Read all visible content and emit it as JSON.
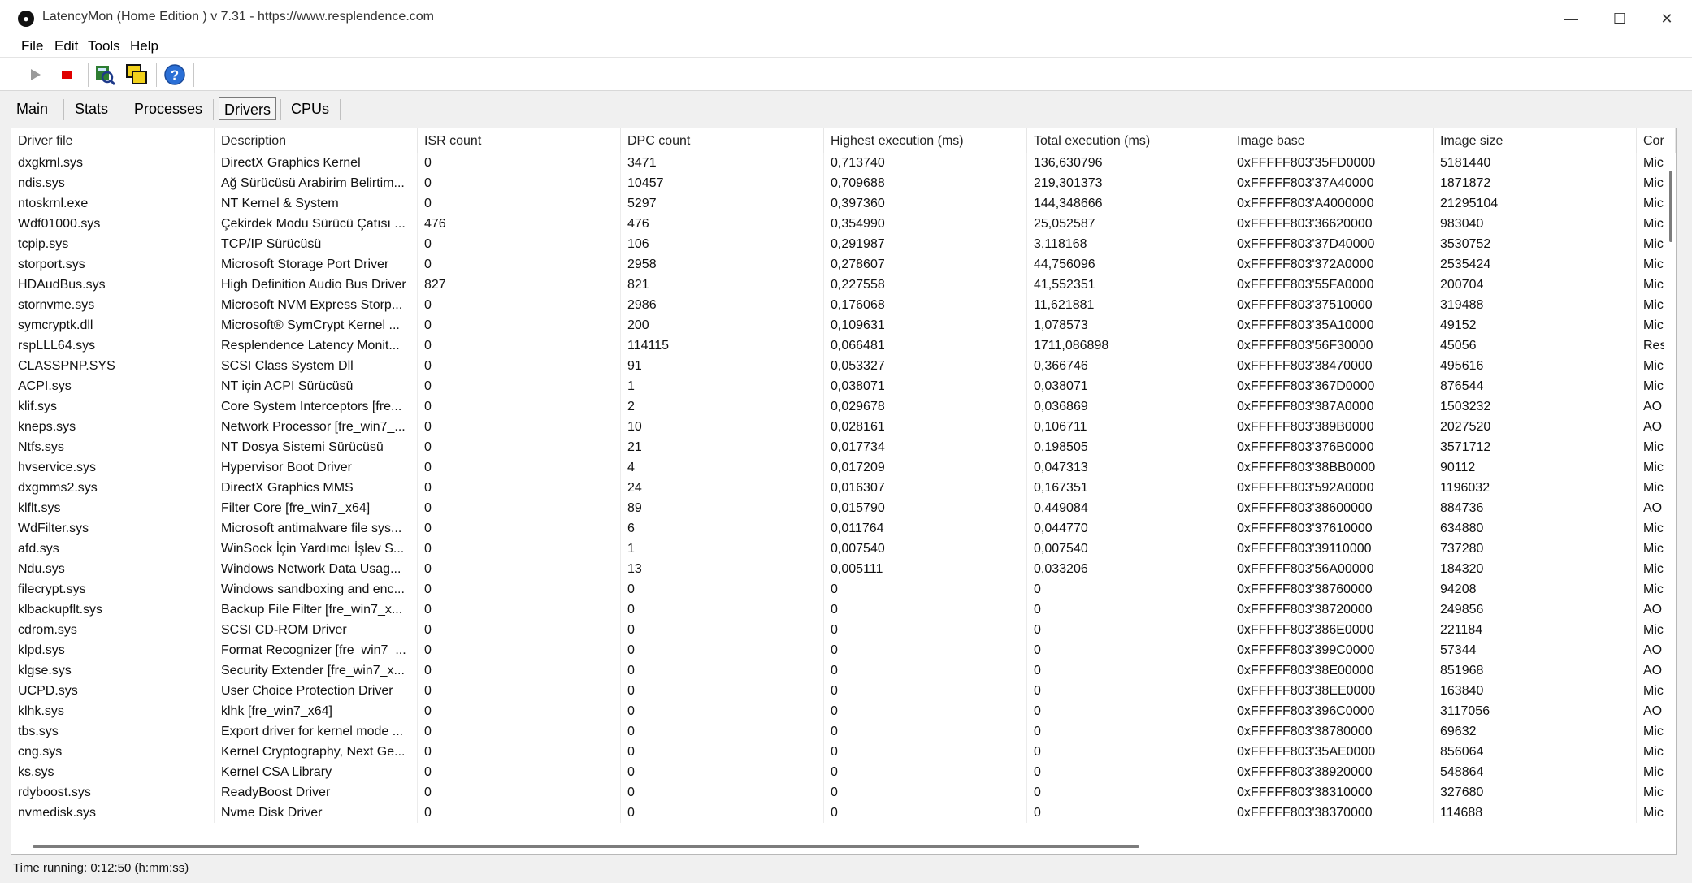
{
  "window": {
    "title": "LatencyMon  (Home Edition )  v 7.31 - https://www.resplendence.com",
    "minimize": "—",
    "maximize": "☐",
    "close": "✕"
  },
  "menu": [
    {
      "label": "File"
    },
    {
      "label": "Edit"
    },
    {
      "label": "Tools"
    },
    {
      "label": "Help"
    }
  ],
  "toolbar": {
    "play_icon": "play-icon",
    "stop_icon": "stop-icon",
    "color_stop": "#e00000",
    "color_help": "#2a6fd6"
  },
  "tabs": [
    {
      "label": "Main"
    },
    {
      "label": "Stats"
    },
    {
      "label": "Processes"
    },
    {
      "label": "Drivers",
      "active": true
    },
    {
      "label": "CPUs"
    }
  ],
  "table": {
    "columns": [
      "Driver file",
      "Description",
      "ISR count",
      "DPC count",
      "Highest execution (ms)",
      "Total execution (ms)",
      "Image base",
      "Image size",
      "Cor"
    ],
    "rows": [
      [
        "dxgkrnl.sys",
        "DirectX Graphics Kernel",
        "0",
        "3471",
        "0,713740",
        "136,630796",
        "0xFFFFF803'35FD0000",
        "5181440",
        "Mic"
      ],
      [
        "ndis.sys",
        "Ağ Sürücüsü Arabirim Belirtim...",
        "0",
        "10457",
        "0,709688",
        "219,301373",
        "0xFFFFF803'37A40000",
        "1871872",
        "Mic"
      ],
      [
        "ntoskrnl.exe",
        "NT Kernel & System",
        "0",
        "5297",
        "0,397360",
        "144,348666",
        "0xFFFFF803'A4000000",
        "21295104",
        "Mic"
      ],
      [
        "Wdf01000.sys",
        "Çekirdek Modu Sürücü Çatısı ...",
        "476",
        "476",
        "0,354990",
        "25,052587",
        "0xFFFFF803'36620000",
        "983040",
        "Mic"
      ],
      [
        "tcpip.sys",
        "TCP/IP Sürücüsü",
        "0",
        "106",
        "0,291987",
        "3,118168",
        "0xFFFFF803'37D40000",
        "3530752",
        "Mic"
      ],
      [
        "storport.sys",
        "Microsoft Storage Port Driver",
        "0",
        "2958",
        "0,278607",
        "44,756096",
        "0xFFFFF803'372A0000",
        "2535424",
        "Mic"
      ],
      [
        "HDAudBus.sys",
        "High Definition Audio Bus Driver",
        "827",
        "821",
        "0,227558",
        "41,552351",
        "0xFFFFF803'55FA0000",
        "200704",
        "Mic"
      ],
      [
        "stornvme.sys",
        "Microsoft NVM Express Storp...",
        "0",
        "2986",
        "0,176068",
        "11,621881",
        "0xFFFFF803'37510000",
        "319488",
        "Mic"
      ],
      [
        "symcryptk.dll",
        "Microsoft® SymCrypt Kernel ...",
        "0",
        "200",
        "0,109631",
        "1,078573",
        "0xFFFFF803'35A10000",
        "49152",
        "Mic"
      ],
      [
        "rspLLL64.sys",
        "Resplendence Latency Monit...",
        "0",
        "114115",
        "0,066481",
        "1711,086898",
        "0xFFFFF803'56F30000",
        "45056",
        "Res"
      ],
      [
        "CLASSPNP.SYS",
        "SCSI Class System Dll",
        "0",
        "91",
        "0,053327",
        "0,366746",
        "0xFFFFF803'38470000",
        "495616",
        "Mic"
      ],
      [
        "ACPI.sys",
        "NT için ACPI Sürücüsü",
        "0",
        "1",
        "0,038071",
        "0,038071",
        "0xFFFFF803'367D0000",
        "876544",
        "Mic"
      ],
      [
        "klif.sys",
        "Core System Interceptors [fre...",
        "0",
        "2",
        "0,029678",
        "0,036869",
        "0xFFFFF803'387A0000",
        "1503232",
        "AO"
      ],
      [
        "kneps.sys",
        "Network Processor [fre_win7_...",
        "0",
        "10",
        "0,028161",
        "0,106711",
        "0xFFFFF803'389B0000",
        "2027520",
        "AO"
      ],
      [
        "Ntfs.sys",
        "NT Dosya Sistemi Sürücüsü",
        "0",
        "21",
        "0,017734",
        "0,198505",
        "0xFFFFF803'376B0000",
        "3571712",
        "Mic"
      ],
      [
        "hvservice.sys",
        "Hypervisor Boot Driver",
        "0",
        "4",
        "0,017209",
        "0,047313",
        "0xFFFFF803'38BB0000",
        "90112",
        "Mic"
      ],
      [
        "dxgmms2.sys",
        "DirectX Graphics MMS",
        "0",
        "24",
        "0,016307",
        "0,167351",
        "0xFFFFF803'592A0000",
        "1196032",
        "Mic"
      ],
      [
        "klflt.sys",
        "Filter Core [fre_win7_x64]",
        "0",
        "89",
        "0,015790",
        "0,449084",
        "0xFFFFF803'38600000",
        "884736",
        "AO"
      ],
      [
        "WdFilter.sys",
        "Microsoft antimalware file sys...",
        "0",
        "6",
        "0,011764",
        "0,044770",
        "0xFFFFF803'37610000",
        "634880",
        "Mic"
      ],
      [
        "afd.sys",
        "WinSock İçin Yardımcı İşlev S...",
        "0",
        "1",
        "0,007540",
        "0,007540",
        "0xFFFFF803'39110000",
        "737280",
        "Mic"
      ],
      [
        "Ndu.sys",
        "Windows Network Data Usag...",
        "0",
        "13",
        "0,005111",
        "0,033206",
        "0xFFFFF803'56A00000",
        "184320",
        "Mic"
      ],
      [
        "filecrypt.sys",
        "Windows sandboxing and enc...",
        "0",
        "0",
        "0",
        "0",
        "0xFFFFF803'38760000",
        "94208",
        "Mic"
      ],
      [
        "klbackupflt.sys",
        "Backup File Filter [fre_win7_x...",
        "0",
        "0",
        "0",
        "0",
        "0xFFFFF803'38720000",
        "249856",
        "AO"
      ],
      [
        "cdrom.sys",
        "SCSI CD-ROM Driver",
        "0",
        "0",
        "0",
        "0",
        "0xFFFFF803'386E0000",
        "221184",
        "Mic"
      ],
      [
        "klpd.sys",
        "Format Recognizer [fre_win7_...",
        "0",
        "0",
        "0",
        "0",
        "0xFFFFF803'399C0000",
        "57344",
        "AO"
      ],
      [
        "klgse.sys",
        "Security Extender [fre_win7_x...",
        "0",
        "0",
        "0",
        "0",
        "0xFFFFF803'38E00000",
        "851968",
        "AO"
      ],
      [
        "UCPD.sys",
        "User Choice Protection Driver",
        "0",
        "0",
        "0",
        "0",
        "0xFFFFF803'38EE0000",
        "163840",
        "Mic"
      ],
      [
        "klhk.sys",
        "klhk [fre_win7_x64]",
        "0",
        "0",
        "0",
        "0",
        "0xFFFFF803'396C0000",
        "3117056",
        "AO"
      ],
      [
        "tbs.sys",
        "Export driver for kernel mode ...",
        "0",
        "0",
        "0",
        "0",
        "0xFFFFF803'38780000",
        "69632",
        "Mic"
      ],
      [
        "cng.sys",
        "Kernel Cryptography, Next Ge...",
        "0",
        "0",
        "0",
        "0",
        "0xFFFFF803'35AE0000",
        "856064",
        "Mic"
      ],
      [
        "ks.sys",
        "Kernel CSA Library",
        "0",
        "0",
        "0",
        "0",
        "0xFFFFF803'38920000",
        "548864",
        "Mic"
      ],
      [
        "rdyboost.sys",
        "ReadyBoost Driver",
        "0",
        "0",
        "0",
        "0",
        "0xFFFFF803'38310000",
        "327680",
        "Mic"
      ],
      [
        "nvmedisk.sys",
        "Nvme Disk Driver",
        "0",
        "0",
        "0",
        "0",
        "0xFFFFF803'38370000",
        "114688",
        "Mic"
      ]
    ]
  },
  "status": {
    "text": "Time running: 0:12:50  (h:mm:ss)"
  }
}
